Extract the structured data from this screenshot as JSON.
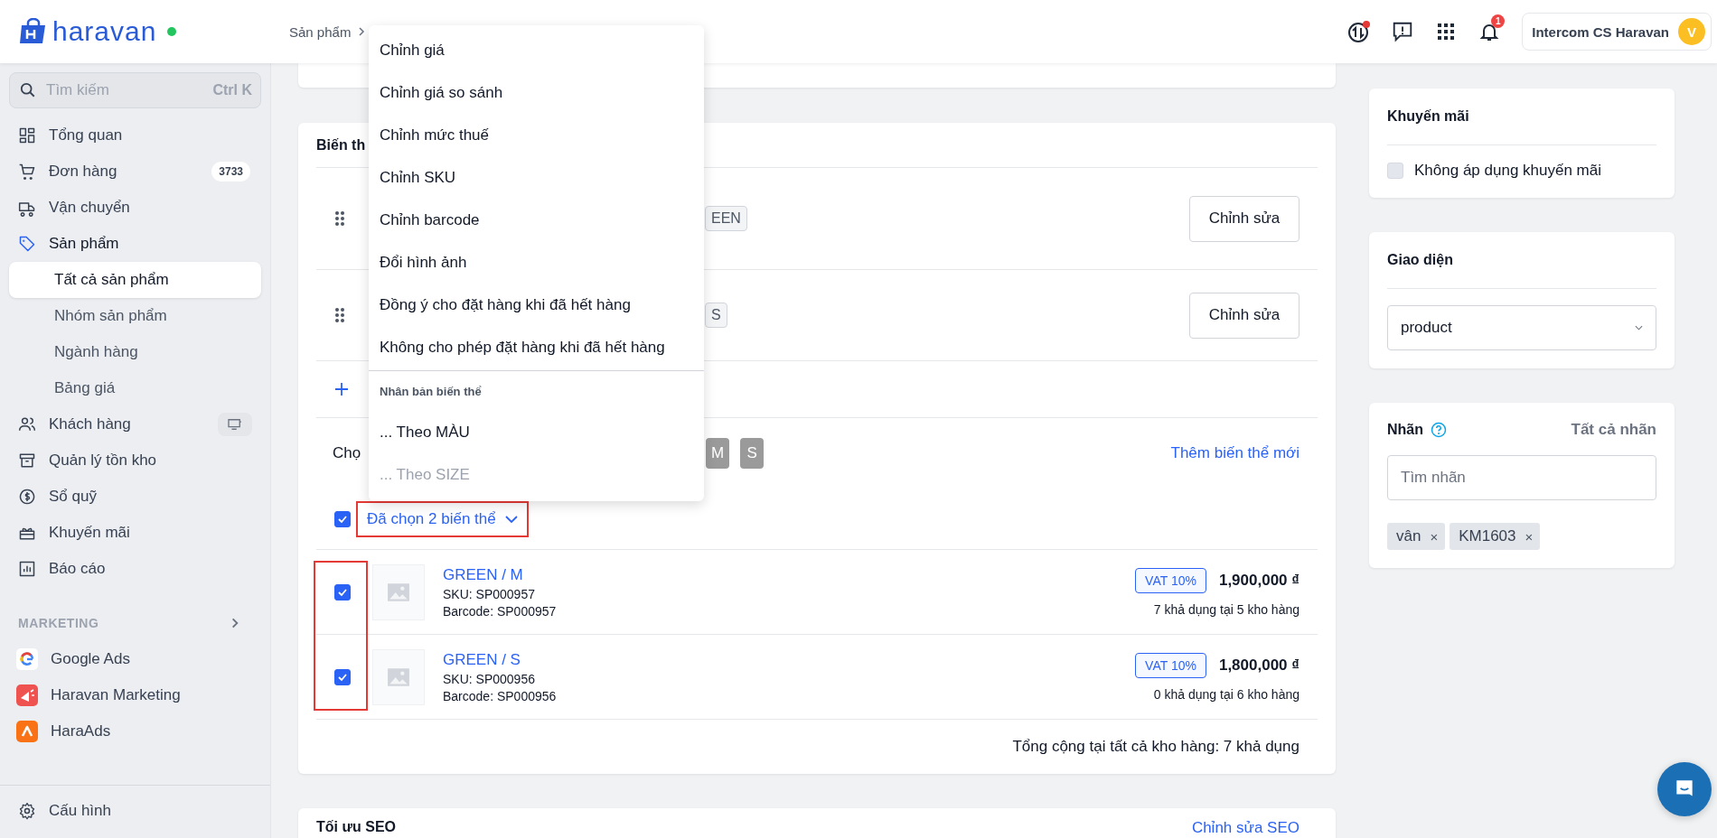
{
  "header": {
    "logo": "haravan",
    "online": true,
    "breadcrumb": "Sản phẩm",
    "notifications": "1",
    "account": {
      "name": "Intercom CS Haravan",
      "avatar": "V"
    }
  },
  "sidebar": {
    "search": {
      "placeholder": "Tìm kiếm",
      "shortcut": "Ctrl K"
    },
    "items": [
      {
        "label": "Tổng quan",
        "expanded": false
      },
      {
        "label": "Đơn hàng",
        "badge": "3733",
        "expanded": false
      },
      {
        "label": "Vận chuyển",
        "expanded": false
      },
      {
        "label": "Sản phẩm",
        "expanded": true,
        "children": [
          {
            "label": "Tất cả sản phẩm",
            "selected": true
          },
          {
            "label": "Nhóm sản phẩm",
            "selected": false
          },
          {
            "label": "Ngành hàng",
            "selected": false
          },
          {
            "label": "Bảng giá",
            "selected": false
          }
        ]
      },
      {
        "label": "Khách hàng",
        "expanded": false
      },
      {
        "label": "Quản lý tồn kho",
        "expanded": false
      },
      {
        "label": "Sổ quỹ",
        "expanded": false
      },
      {
        "label": "Khuyến mãi",
        "expanded": false
      },
      {
        "label": "Báo cáo",
        "expanded": false
      }
    ],
    "section": {
      "title": "MARKETING",
      "items": [
        {
          "label": "Google Ads"
        },
        {
          "label": "Haravan Marketing"
        },
        {
          "label": "HaraAds"
        }
      ]
    },
    "footer": "Cấu hình"
  },
  "variants_card": {
    "title": "Biến th",
    "options": [
      {
        "tag": "EEN",
        "button": "Chỉnh sửa"
      },
      {
        "tag": "S",
        "button": "Chỉnh sửa"
      }
    ],
    "select_label": "Chọ",
    "value_chips": [
      "M",
      "S"
    ],
    "add_link": "Thêm biến thể mới",
    "select_all": {
      "checked": true,
      "label": "Đã chọn 2 biến thể"
    },
    "variants": [
      {
        "checked": true,
        "title": "GREEN / M",
        "sku": "SKU: SP000957",
        "barcode": "Barcode: SP000957",
        "tax": "VAT 10%",
        "price": "1,900,000 ₫",
        "stock": "7 khả dụng tại 5 kho hàng"
      },
      {
        "checked": true,
        "title": "GREEN / S",
        "sku": "SKU: SP000956",
        "barcode": "Barcode: SP000956",
        "tax": "VAT 10%",
        "price": "1,800,000 ₫",
        "stock": "0 khả dụng tại 6 kho hàng"
      }
    ],
    "total": "Tổng cộng tại tất cả kho hàng: 7 khả dụng"
  },
  "bulk_menu": [
    {
      "kind": "action",
      "label": "Chỉnh giá",
      "disabled": false
    },
    {
      "kind": "action",
      "label": "Chỉnh giá so sánh",
      "disabled": false
    },
    {
      "kind": "action",
      "label": "Chỉnh mức thuế",
      "disabled": false
    },
    {
      "kind": "action",
      "label": "Chỉnh SKU",
      "disabled": false
    },
    {
      "kind": "action",
      "label": "Chỉnh barcode",
      "disabled": false
    },
    {
      "kind": "action",
      "label": "Đổi hình ảnh",
      "disabled": false
    },
    {
      "kind": "action",
      "label": "Đồng ý cho đặt hàng khi đã hết hàng",
      "disabled": false
    },
    {
      "kind": "action",
      "label": "Không cho phép đặt hàng khi đã hết hàng",
      "disabled": false
    },
    {
      "kind": "header",
      "label": "Nhân bản biến thể"
    },
    {
      "kind": "action",
      "label": "... Theo MÀU",
      "disabled": false
    },
    {
      "kind": "action",
      "label": "... Theo SIZE",
      "disabled": true
    }
  ],
  "promotion": {
    "title": "Khuyến mãi",
    "checkbox": {
      "label": "Không áp dụng khuyến mãi",
      "checked": false
    }
  },
  "template": {
    "title": "Giao diện",
    "value": "product"
  },
  "labels": {
    "title": "Nhãn",
    "link": "Tất cả nhãn",
    "placeholder": "Tìm nhãn",
    "tags": [
      "vân",
      "KM1603"
    ],
    "remove": "×"
  },
  "seo": {
    "title": "Tối ưu SEO",
    "link": "Chỉnh sửa SEO"
  }
}
